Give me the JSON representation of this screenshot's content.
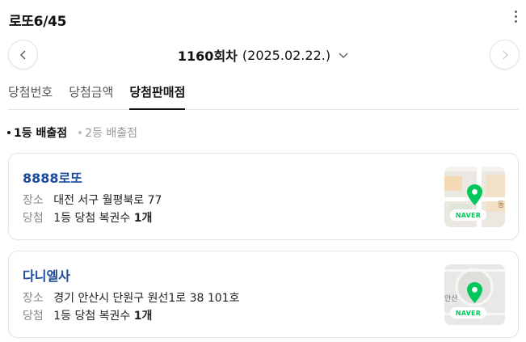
{
  "header": {
    "title": "로또6/45"
  },
  "round": {
    "number": "1160회차",
    "date": "(2025.02.22.)"
  },
  "tabs": [
    {
      "label": "당첨번호",
      "active": false
    },
    {
      "label": "당첨금액",
      "active": false
    },
    {
      "label": "당첨판매점",
      "active": true
    }
  ],
  "subtabs": [
    {
      "label": "1등 배출점",
      "active": true
    },
    {
      "label": "2등 배출점",
      "active": false
    }
  ],
  "stores": [
    {
      "name": "8888로또",
      "address_label": "장소",
      "address": "대전 서구 월평북로 77",
      "win_label": "당첨",
      "win_text": "1등 당첨 복권수",
      "win_count": "1개",
      "map_badge": "NAVER",
      "map_text": "동"
    },
    {
      "name": "다니엘사",
      "address_label": "장소",
      "address": "경기 안산시 단원구 원선1로 38 101호",
      "win_label": "당첨",
      "win_text": "1등 당첨 복권수",
      "win_count": "1개",
      "map_badge": "NAVER",
      "map_text": "안산"
    }
  ],
  "colors": {
    "store_name": "#1a4a9c",
    "naver_green": "#03c75a",
    "active_tab": "#111111"
  }
}
